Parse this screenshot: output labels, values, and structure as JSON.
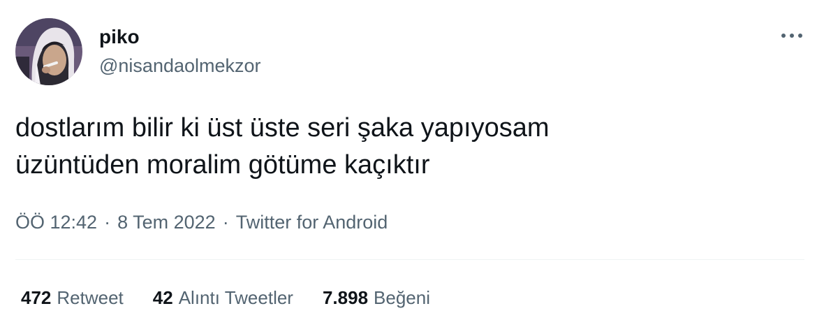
{
  "author": {
    "display_name": "piko",
    "handle": "@nisandaolmekzor",
    "avatar_icon": "profile-photo"
  },
  "menu": {
    "more_icon": "more-horizontal-icon"
  },
  "tweet": {
    "text": "dostlarım bilir ki üst üste seri şaka yapıyosam\nüzüntüden moralim götüme kaçıktır",
    "time": "ÖÖ 12:42",
    "date": "8 Tem 2022",
    "source": "Twitter for Android",
    "separator": "·"
  },
  "stats": {
    "retweets": {
      "count": "472",
      "label": "Retweet"
    },
    "quotes": {
      "count": "42",
      "label": "Alıntı Tweetler"
    },
    "likes": {
      "count": "7.898",
      "label": "Beğeni"
    }
  },
  "colors": {
    "text_primary": "#0f1419",
    "text_secondary": "#536471",
    "divider": "#eff3f4",
    "background": "#ffffff"
  }
}
